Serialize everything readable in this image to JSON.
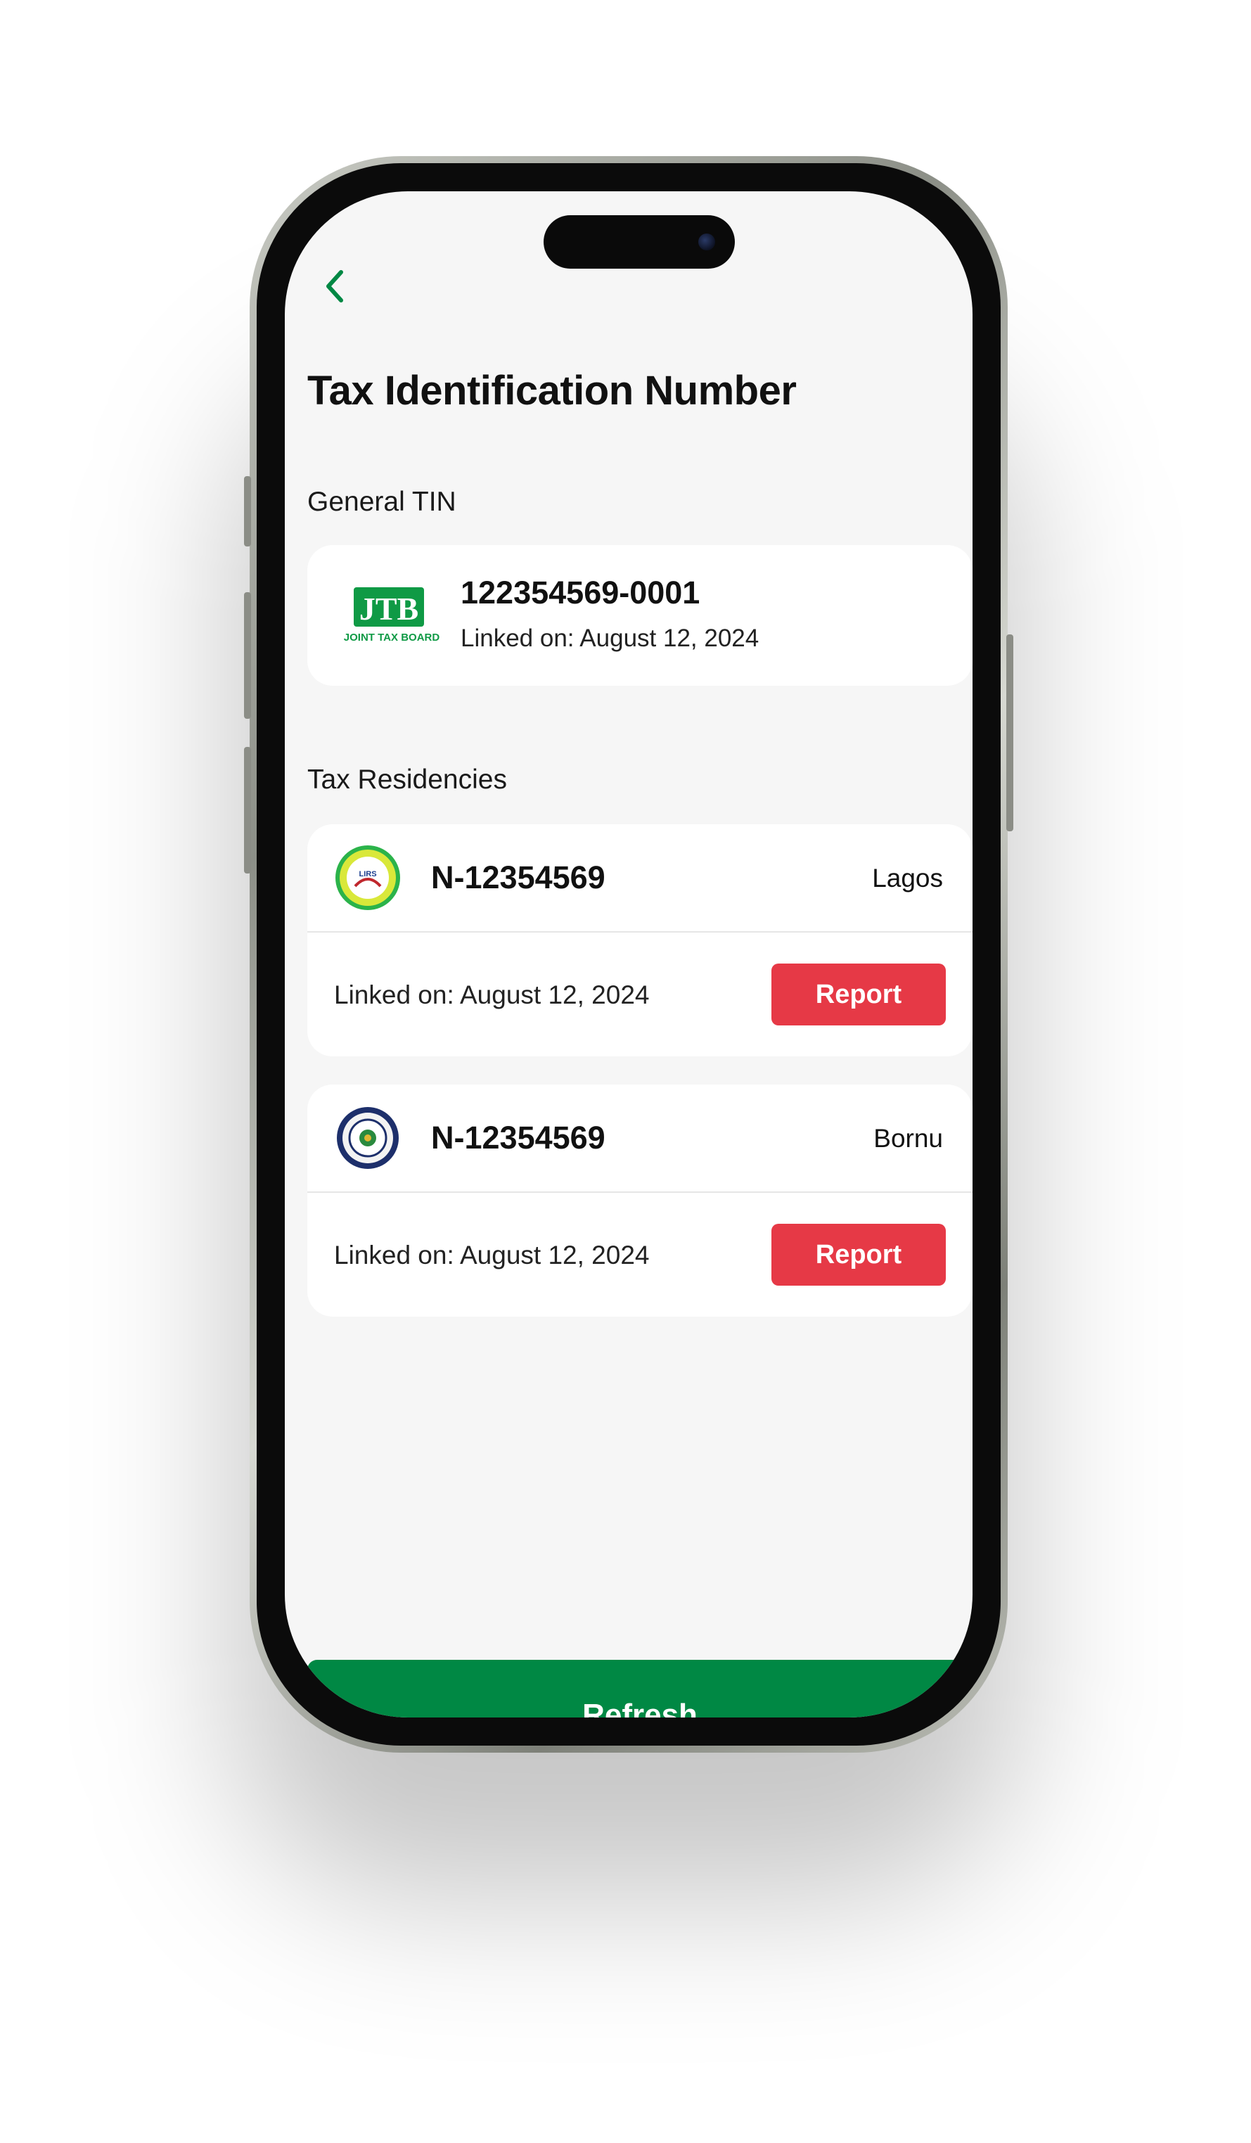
{
  "header": {
    "back_icon": "chevron-left-icon",
    "title": "Tax Identification Number"
  },
  "general_tin": {
    "section_label": "General TIN",
    "logo_text": "JTB",
    "logo_caption": "JOINT TAX BOARD",
    "number": "122354569-0001",
    "linked": "Linked on: August 12, 2024"
  },
  "residencies": {
    "section_label": "Tax Residencies",
    "items": [
      {
        "id": "N-12354569",
        "state": "Lagos",
        "seal_text": "LIRS",
        "linked": "Linked on: August 12, 2024",
        "report_label": "Report"
      },
      {
        "id": "N-12354569",
        "state": "Bornu",
        "linked": "Linked on: August 12, 2024",
        "report_label": "Report"
      }
    ]
  },
  "footer": {
    "refresh_label": "Refresh"
  },
  "colors": {
    "brand_green": "#008844",
    "report_red": "#e63946",
    "screen_bg": "#f6f6f6"
  }
}
